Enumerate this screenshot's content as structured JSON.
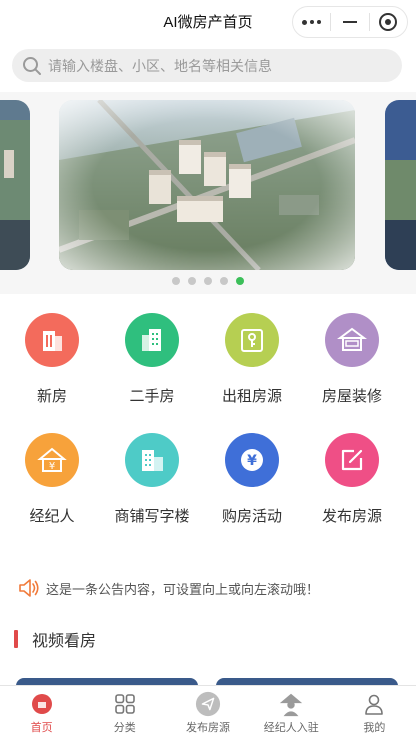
{
  "header": {
    "title": "AI微房产首页"
  },
  "search": {
    "placeholder": "请输入楼盘、小区、地名等相关信息"
  },
  "carousel": {
    "count": 5,
    "active_index": 4
  },
  "grid": [
    {
      "label": "新房",
      "icon": "building-icon",
      "color": "#f36b5c"
    },
    {
      "label": "二手房",
      "icon": "apartment-icon",
      "color": "#2fbf7e"
    },
    {
      "label": "出租房源",
      "icon": "door-key-icon",
      "color": "#b6cf52"
    },
    {
      "label": "房屋装修",
      "icon": "house-renovation-icon",
      "color": "#b08fc7"
    },
    {
      "label": "经纪人",
      "icon": "agent-house-icon",
      "color": "#f7a23b"
    },
    {
      "label": "商铺写字楼",
      "icon": "office-building-icon",
      "color": "#4ecbc7"
    },
    {
      "label": "购房活动",
      "icon": "yuan-coin-icon",
      "color": "#3f6fd8"
    },
    {
      "label": "发布房源",
      "icon": "edit-icon",
      "color": "#ef4f86"
    }
  ],
  "notice": {
    "text": "这是一条公告内容，可设置向上或向左滚动哦！"
  },
  "section": {
    "title": "视频看房"
  },
  "tabbar": [
    {
      "label": "首页",
      "icon": "home-icon",
      "active": true
    },
    {
      "label": "分类",
      "icon": "category-icon",
      "active": false
    },
    {
      "label": "发布房源",
      "icon": "send-icon",
      "active": false
    },
    {
      "label": "经纪人入驻",
      "icon": "agent-icon",
      "active": false
    },
    {
      "label": "我的",
      "icon": "profile-icon",
      "active": false
    }
  ],
  "colors": {
    "accent": "#e04a4a",
    "indicator_active": "#3cbf5a"
  }
}
